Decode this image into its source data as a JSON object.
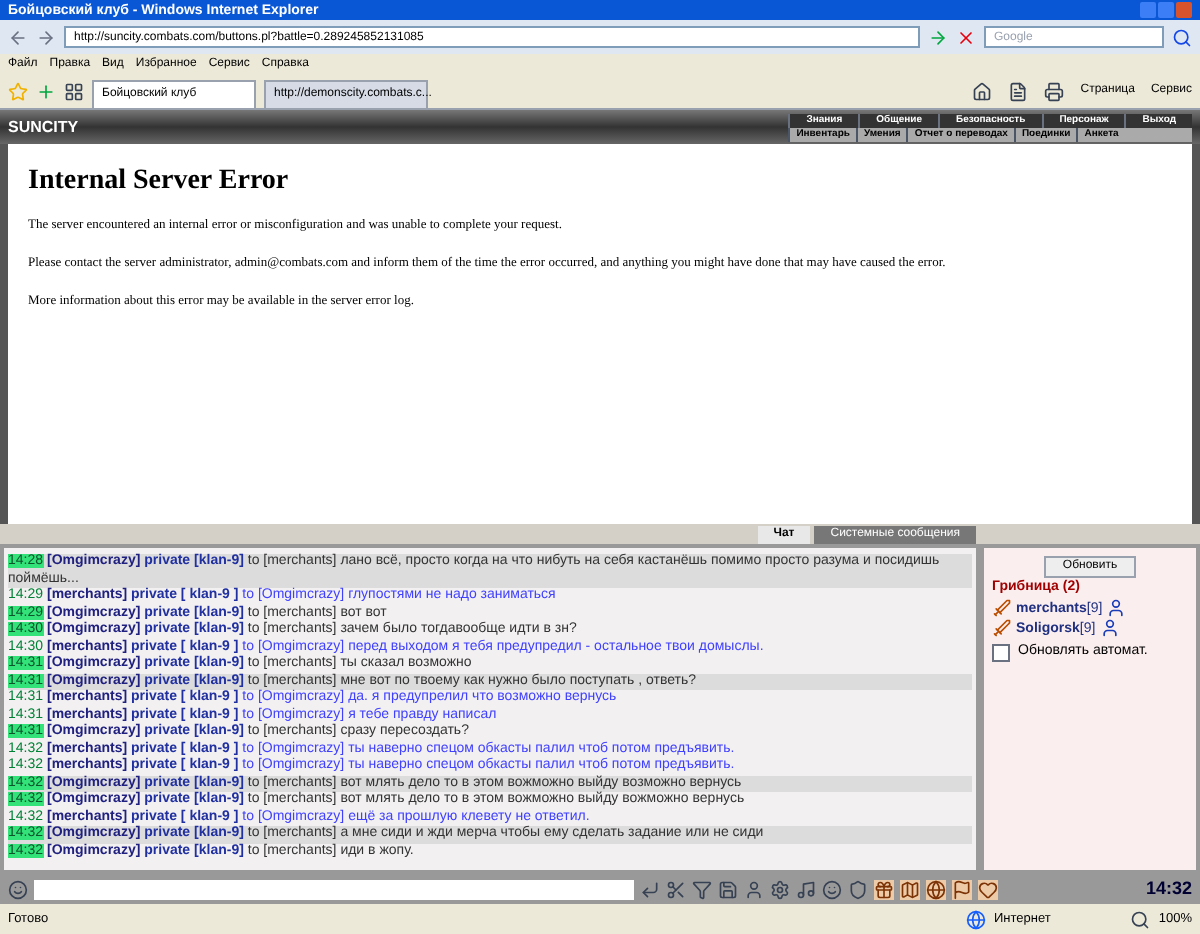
{
  "browser": {
    "title": "Бойцовский клуб - Windows Internet Explorer",
    "address": "http://suncity.combats.com/buttons.pl?battle=0.289245852131085",
    "search_placeholder": "Google",
    "menu": [
      "Файл",
      "Правка",
      "Вид",
      "Избранное",
      "Сервис",
      "Справка"
    ],
    "tabs": [
      {
        "label": "Бойцовский клуб",
        "selected": true
      },
      {
        "label": "http://demonscity.combats.c...",
        "selected": false
      }
    ],
    "toolbar": [
      "Страница",
      "Сервис"
    ]
  },
  "game_nav": {
    "logo": "SUNCITY",
    "top_links": [
      "Знания",
      "Общение",
      "Безопасность",
      "Персонаж",
      "Выход"
    ],
    "sub_links": [
      "Инвентарь",
      "Умения",
      "Отчет о переводах",
      "Поединки",
      "Анкета"
    ]
  },
  "error_page": {
    "heading": "Internal Server Error",
    "paragraphs": [
      "The server encountered an internal error or misconfiguration and was unable to complete your request.",
      "Please contact the server administrator, admin@combats.com and inform them of the time the error occurred, and anything you might have done that may have caused the error.",
      "More information about this error may be available in the server error log."
    ]
  },
  "chat": {
    "tabs": [
      {
        "label": "Чат",
        "selected": true
      },
      {
        "label": "Системные сообщения",
        "selected": false
      }
    ],
    "messages": [
      {
        "kind": "incoming",
        "time": "14:28",
        "from": "[Omgimcrazy]",
        "channel": "private [klan-9]",
        "to": "to [merchants]",
        "text": "лано всё, просто когда на что нибуть на себя кастанёшь помимо просто разума и посидишь поймёшь...",
        "highlighted": true
      },
      {
        "kind": "outgoing",
        "time": "14:29",
        "from": "[merchants]",
        "channel": "private [ klan-9 ]",
        "to": "to [Omgimcrazy]",
        "text": "глупостями не надо заниматься",
        "highlighted": false
      },
      {
        "kind": "incoming",
        "time": "14:29",
        "from": "[Omgimcrazy]",
        "channel": "private [klan-9]",
        "to": "to [merchants]",
        "text": "вот вот",
        "highlighted": false
      },
      {
        "kind": "incoming",
        "time": "14:30",
        "from": "[Omgimcrazy]",
        "channel": "private [klan-9]",
        "to": "to [merchants]",
        "text": "зачем было тогдавообще идти в зн?",
        "highlighted": false
      },
      {
        "kind": "outgoing",
        "time": "14:30",
        "from": "[merchants]",
        "channel": "private [ klan-9 ]",
        "to": "to [Omgimcrazy]",
        "text": "перед выходом я тебя предупредил - остальное твои домыслы.",
        "highlighted": false
      },
      {
        "kind": "incoming",
        "time": "14:31",
        "from": "[Omgimcrazy]",
        "channel": "private [klan-9]",
        "to": "to [merchants]",
        "text": "ты сказал возможно",
        "highlighted": false
      },
      {
        "kind": "incoming",
        "time": "14:31",
        "from": "[Omgimcrazy]",
        "channel": "private [klan-9]",
        "to": "to [merchants]",
        "text": "мне вот по твоему как нужно было поступать , ответь?",
        "highlighted": true
      },
      {
        "kind": "outgoing",
        "time": "14:31",
        "from": "[merchants]",
        "channel": "private [ klan-9 ]",
        "to": "to [Omgimcrazy]",
        "text": "да. я предупрелил что возможно вернусь",
        "highlighted": false
      },
      {
        "kind": "outgoing",
        "time": "14:31",
        "from": "[merchants]",
        "channel": "private [ klan-9 ]",
        "to": "to [Omgimcrazy]",
        "text": "я тебе правду написал",
        "highlighted": false
      },
      {
        "kind": "incoming",
        "time": "14:31",
        "from": "[Omgimcrazy]",
        "channel": "private [klan-9]",
        "to": "to [merchants]",
        "text": "сразу пересоздать?",
        "highlighted": false
      },
      {
        "kind": "outgoing",
        "time": "14:32",
        "from": "[merchants]",
        "channel": "private [ klan-9 ]",
        "to": "to [Omgimcrazy]",
        "text": "ты наверно спецом обкасты палил чтоб потом предъявить.",
        "highlighted": false
      },
      {
        "kind": "outgoing",
        "time": "14:32",
        "from": "[merchants]",
        "channel": "private [ klan-9 ]",
        "to": "to [Omgimcrazy]",
        "text": "ты наверно спецом обкасты палил чтоб потом предъявить.",
        "highlighted": false
      },
      {
        "kind": "incoming",
        "time": "14:32",
        "from": "[Omgimcrazy]",
        "channel": "private [klan-9]",
        "to": "to [merchants]",
        "text": "вот млять дело то в этом вожможно выйду возможно вернусь",
        "highlighted": true
      },
      {
        "kind": "incoming",
        "time": "14:32",
        "from": "[Omgimcrazy]",
        "channel": "private [klan-9]",
        "to": "to [merchants]",
        "text": "вот млять дело то в этом вожможно выйду вожможно вернусь",
        "highlighted": false
      },
      {
        "kind": "outgoing",
        "time": "14:32",
        "from": "[merchants]",
        "channel": "private [ klan-9 ]",
        "to": "to [Omgimcrazy]",
        "text": "ещё за прошлую клевету не ответил.",
        "highlighted": false
      },
      {
        "kind": "incoming",
        "time": "14:32",
        "from": "[Omgimcrazy]",
        "channel": "private [klan-9]",
        "to": "to [merchants]",
        "text": "а мне сиди и жди мерча чтобы ему сделать задание или не сиди",
        "highlighted": true
      },
      {
        "kind": "incoming",
        "time": "14:32",
        "from": "[Omgimcrazy]",
        "channel": "private [klan-9]",
        "to": "to [merchants]",
        "text": "иди в жопу.",
        "highlighted": false
      }
    ]
  },
  "online": {
    "refresh_button": "Обновить",
    "room": "Грибница (2)",
    "users": [
      {
        "name": "merchants",
        "level": "[9]"
      },
      {
        "name": "Soligorsk",
        "level": "[9]"
      }
    ],
    "auto_refresh": {
      "label": "Обновлять автомат.",
      "checked": false
    }
  },
  "bottom_bar": {
    "clock": "14:32"
  },
  "status_bar": {
    "status": "Готово",
    "zone": "Интернет",
    "zoom": "100%"
  }
}
